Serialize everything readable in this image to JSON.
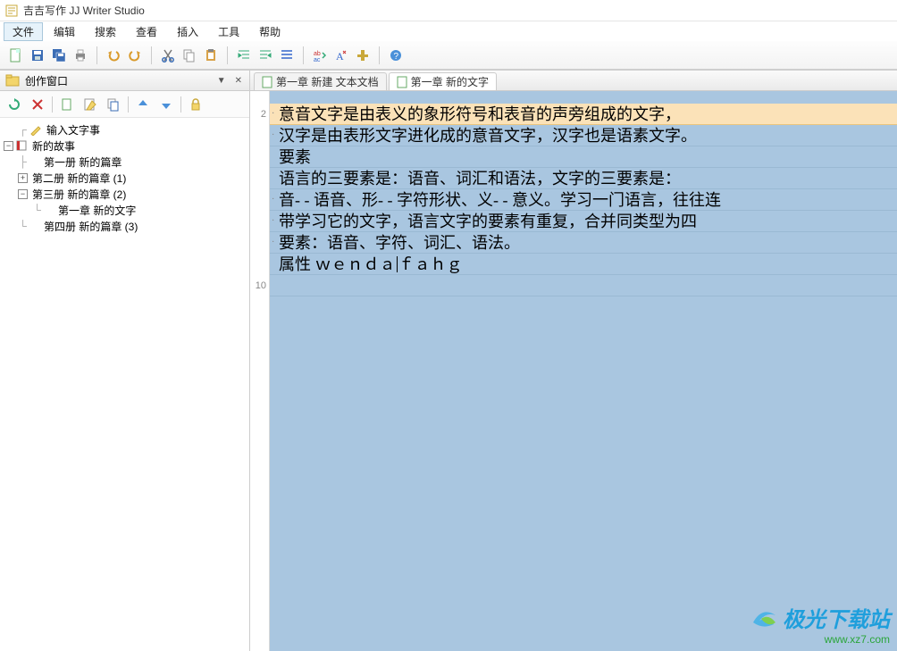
{
  "window": {
    "title": "吉吉写作 JJ Writer Studio"
  },
  "menu": {
    "file": "文件",
    "edit": "编辑",
    "search": "搜索",
    "view": "查看",
    "insert": "插入",
    "tools": "工具",
    "help": "帮助"
  },
  "sidebar": {
    "panel_title": "创作窗口",
    "input_placeholder": "输入文字事",
    "tree": {
      "root": "新的故事",
      "book1": "第一册 新的篇章",
      "book2": "第二册 新的篇章 (1)",
      "book3": "第三册 新的篇章 (2)",
      "book3_ch1": "第一章 新的文字",
      "book4": "第四册 新的篇章 (3)"
    }
  },
  "tabs": {
    "t1": "第一章 新建 文本文档",
    "t2": "第一章 新的文字"
  },
  "gutter": {
    "ln2": "2",
    "ln10": "10"
  },
  "lines": {
    "l2": "意音文字是由表义的象形符号和表音的声旁组成的文字，",
    "l3": "汉字是由表形文字进化成的意音文字，汉字也是语素文字。",
    "l4": "要素",
    "l5": "语言的三要素是：语音、词汇和语法，文字的三要素是：",
    "l6": "音- - 语音、形- - 字符形状、义- - 意义。学习一门语言，往往连",
    "l7": "带学习它的文字，语言文字的要素有重复，合并同类型为四",
    "l8": "要素：语音、字符、词汇、语法。",
    "l9_a": "属性  ｗｅｎｄａ",
    "l9_b": "ｆａｈｇ"
  },
  "watermark": {
    "brand": "极光下载站",
    "url": "www.xz7.com"
  }
}
